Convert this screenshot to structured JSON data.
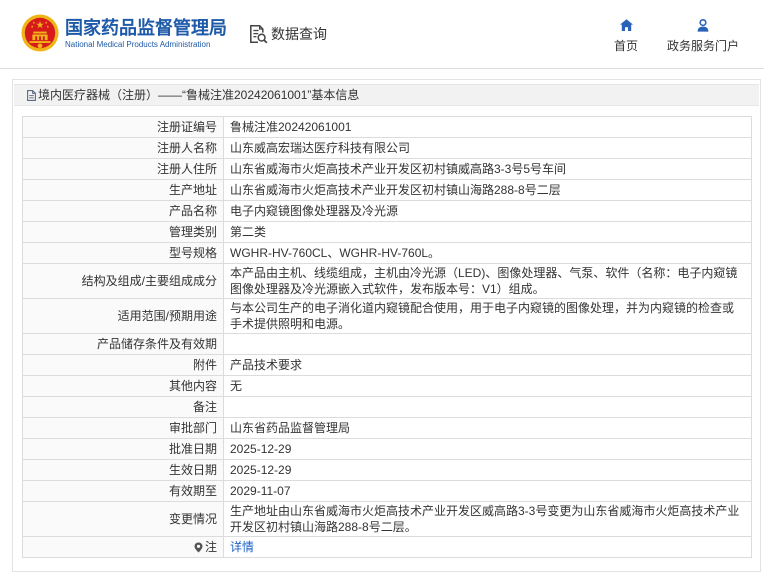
{
  "header": {
    "org_name_cn": "国家药品监督管理局",
    "org_name_en": "National Medical Products Administration",
    "section_title": "数据查询",
    "section_icon": "document-search-icon",
    "nav": [
      {
        "label": "首页",
        "icon": "home-icon"
      },
      {
        "label": "政务服务门户",
        "icon": "user-icon"
      }
    ]
  },
  "panel": {
    "title_icon": "document-icon",
    "title": "境内医疗器械（注册）——“鲁械注准20242061001”基本信息",
    "rows": [
      {
        "label": "注册证编号",
        "value": "鲁械注准20242061001"
      },
      {
        "label": "注册人名称",
        "value": "山东威高宏瑞达医疗科技有限公司"
      },
      {
        "label": "注册人住所",
        "value": "山东省威海市火炬高技术产业开发区初村镇威高路3-3号5号车间"
      },
      {
        "label": "生产地址",
        "value": "山东省威海市火炬高技术产业开发区初村镇山海路288-8号二层"
      },
      {
        "label": "产品名称",
        "value": "电子内窥镜图像处理器及冷光源"
      },
      {
        "label": "管理类别",
        "value": "第二类"
      },
      {
        "label": "型号规格",
        "value": "WGHR-HV-760CL、WGHR-HV-760L。"
      },
      {
        "label": "结构及组成/主要组成成分",
        "value": "本产品由主机、线缆组成，主机由冷光源（LED)、图像处理器、气泵、软件（名称：电子内窥镜图像处理器及冷光源嵌入式软件，发布版本号：V1）组成。"
      },
      {
        "label": "适用范围/预期用途",
        "value": "与本公司生产的电子消化道内窥镜配合使用，用于电子内窥镜的图像处理，并为内窥镜的检查或手术提供照明和电源。"
      },
      {
        "label": "产品储存条件及有效期",
        "value": ""
      },
      {
        "label": "附件",
        "value": "产品技术要求"
      },
      {
        "label": "其他内容",
        "value": "无"
      },
      {
        "label": "备注",
        "value": ""
      },
      {
        "label": "审批部门",
        "value": "山东省药品监督管理局"
      },
      {
        "label": "批准日期",
        "value": "2025-12-29"
      },
      {
        "label": "生效日期",
        "value": "2025-12-29"
      },
      {
        "label": "有效期至",
        "value": "2029-11-07"
      },
      {
        "label": "变更情况",
        "value": "生产地址由山东省威海市火炬高技术产业开发区威高路3-3号变更为山东省威海市火炬高技术产业开发区初村镇山海路288-8号二层。"
      },
      {
        "label": "注",
        "value": "详情",
        "label_icon": "pin-icon"
      }
    ]
  },
  "colors": {
    "brand_blue": "#1f5aa8",
    "link_blue": "#1b63c6",
    "nav_icon_blue": "#2a62b7",
    "border_gray": "#dcdcdc",
    "title_bar_bg": "#f2f2f2"
  }
}
